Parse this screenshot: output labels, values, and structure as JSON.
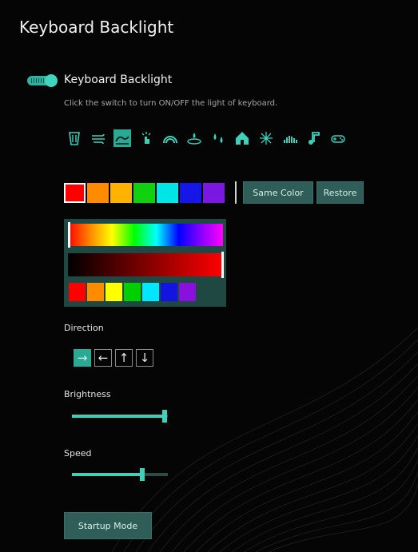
{
  "page": {
    "title": "Keyboard Backlight"
  },
  "backlight": {
    "toggle_on": true,
    "label": "Keyboard Backlight",
    "hint": "Click the switch to turn ON/OFF the light of keyboard."
  },
  "effects": [
    {
      "icon": "static-beam-icon",
      "active": false
    },
    {
      "icon": "wind-gust-icon",
      "active": false
    },
    {
      "icon": "wave-icon",
      "active": true
    },
    {
      "icon": "touch-sparkle-icon",
      "active": false
    },
    {
      "icon": "rainbow-arc-icon",
      "active": false
    },
    {
      "icon": "ripple-drop-icon",
      "active": false
    },
    {
      "icon": "raindrops-icon",
      "active": false
    },
    {
      "icon": "circus-tent-icon",
      "active": false
    },
    {
      "icon": "starburst-icon",
      "active": false
    },
    {
      "icon": "sound-wave-icon",
      "active": false
    },
    {
      "icon": "music-note-icon",
      "active": false
    },
    {
      "icon": "gamepad-icon",
      "active": false
    }
  ],
  "colors": {
    "slots": [
      "#ff0000",
      "#ff8c00",
      "#ffb300",
      "#10d010",
      "#00e6e6",
      "#1616e8",
      "#7a17e0"
    ],
    "selected_index": 0,
    "same_color_label": "Same Color",
    "restore_label": "Restore"
  },
  "picker": {
    "hue": 0,
    "brightness": 1.0,
    "presets": [
      "#ff0000",
      "#ff8c00",
      "#ffff00",
      "#00d000",
      "#00e6ff",
      "#1414e0",
      "#8a10e0"
    ]
  },
  "direction": {
    "label": "Direction",
    "options": [
      {
        "icon": "arrow-right-icon",
        "glyph": "→",
        "active": true
      },
      {
        "icon": "arrow-left-icon",
        "glyph": "←",
        "active": false
      },
      {
        "icon": "arrow-up-icon",
        "glyph": "↑",
        "active": false
      },
      {
        "icon": "arrow-down-icon",
        "glyph": "↓",
        "active": false
      }
    ]
  },
  "brightness": {
    "label": "Brightness",
    "value": 0.97
  },
  "speed": {
    "label": "Speed",
    "value": 0.73
  },
  "startup_label": "Startup Mode",
  "accent": "#2aa995"
}
